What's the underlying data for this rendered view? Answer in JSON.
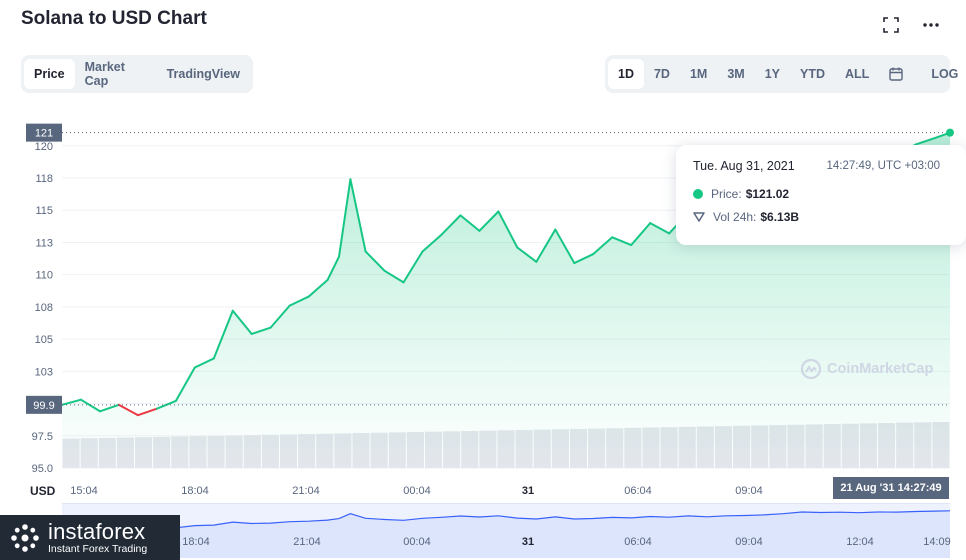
{
  "header": {
    "title": "Solana to USD Chart",
    "expand_icon": "expand-icon",
    "more_icon": "more-dots-icon"
  },
  "tabs": [
    {
      "label": "Price",
      "active": true
    },
    {
      "label": "Market Cap",
      "active": false
    },
    {
      "label": "TradingView",
      "active": false
    }
  ],
  "ranges": [
    {
      "label": "1D",
      "active": true
    },
    {
      "label": "7D",
      "active": false
    },
    {
      "label": "1M",
      "active": false
    },
    {
      "label": "3M",
      "active": false
    },
    {
      "label": "1Y",
      "active": false
    },
    {
      "label": "YTD",
      "active": false
    },
    {
      "label": "ALL",
      "active": false
    }
  ],
  "calendar_icon": "calendar-icon",
  "log_label": "LOG",
  "tooltip": {
    "date": "Tue. Aug 31, 2021",
    "time": "14:27:49, UTC +03:00",
    "price_label": "Price:",
    "price_value": "$121.02",
    "vol_label": "Vol 24h:",
    "vol_value": "$6.13B"
  },
  "watermark": "CoinMarketCap",
  "axis_unit": "USD",
  "crosshair_time": "21 Aug '31 14:27:49",
  "colors": {
    "up": "#16c784",
    "down": "#ea3943",
    "axis_text": "#58667e",
    "tag_bg": "#58667e",
    "nav_line": "#3861fb"
  },
  "logo": {
    "brand": "instaforex",
    "tagline": "Instant Forex Trading"
  },
  "chart_data": {
    "type": "line",
    "ylim": [
      95,
      122
    ],
    "y_ticks": [
      "95.0",
      "97.5",
      "100",
      "103",
      "105",
      "108",
      "110",
      "113",
      "115",
      "118",
      "120"
    ],
    "y_tick_values": [
      95,
      97.5,
      100,
      102.5,
      105,
      107.5,
      110,
      112.5,
      115,
      117.5,
      120
    ],
    "open_price_label": "99.9",
    "open_price": 99.9,
    "last_price_label": "121",
    "last_price": 121.02,
    "x_ticks": [
      "15:04",
      "18:04",
      "21:04",
      "00:04",
      "31",
      "06:04",
      "09:04"
    ],
    "nav_ticks": [
      "18:04",
      "21:04",
      "00:04",
      "31",
      "06:04",
      "09:04",
      "12:04",
      "14:09"
    ],
    "x_hours": [
      0,
      0.5,
      1,
      1.5,
      2,
      2.5,
      3,
      3.5,
      4,
      4.5,
      5,
      5.5,
      6,
      6.5,
      7,
      7.3,
      7.6,
      8,
      8.5,
      9,
      9.5,
      10,
      10.5,
      11,
      11.5,
      12,
      12.5,
      13,
      13.5,
      14,
      14.5,
      15,
      15.5,
      16,
      16.5,
      17,
      17.5,
      18,
      18.5,
      19,
      19.5,
      20,
      20.5,
      21,
      21.5,
      22,
      22.5,
      23,
      23.4
    ],
    "price": [
      99.9,
      100.3,
      99.4,
      99.9,
      99.1,
      99.6,
      100.2,
      102.8,
      103.5,
      107.2,
      105.4,
      105.9,
      107.6,
      108.3,
      109.6,
      111.4,
      117.4,
      111.8,
      110.3,
      109.4,
      111.8,
      113.1,
      114.6,
      113.4,
      114.9,
      112.1,
      111.0,
      113.5,
      110.9,
      111.6,
      112.9,
      112.3,
      114.0,
      113.2,
      114.8,
      113.6,
      114.9,
      115.2,
      116.0,
      117.5,
      119.6,
      118.9,
      119.3,
      118.7,
      119.6,
      119.4,
      120.1,
      120.6,
      121.02
    ],
    "volume": [
      85,
      86,
      87,
      88,
      89,
      90,
      91,
      92,
      93,
      94,
      95,
      96,
      97,
      98,
      99,
      100,
      101,
      102,
      103,
      104,
      105,
      106,
      107,
      108,
      109,
      110,
      111,
      112,
      113,
      114,
      115,
      116,
      117,
      118,
      119,
      120,
      121,
      122,
      123,
      124,
      125,
      126,
      127,
      128,
      129,
      130,
      131,
      132,
      133
    ]
  }
}
